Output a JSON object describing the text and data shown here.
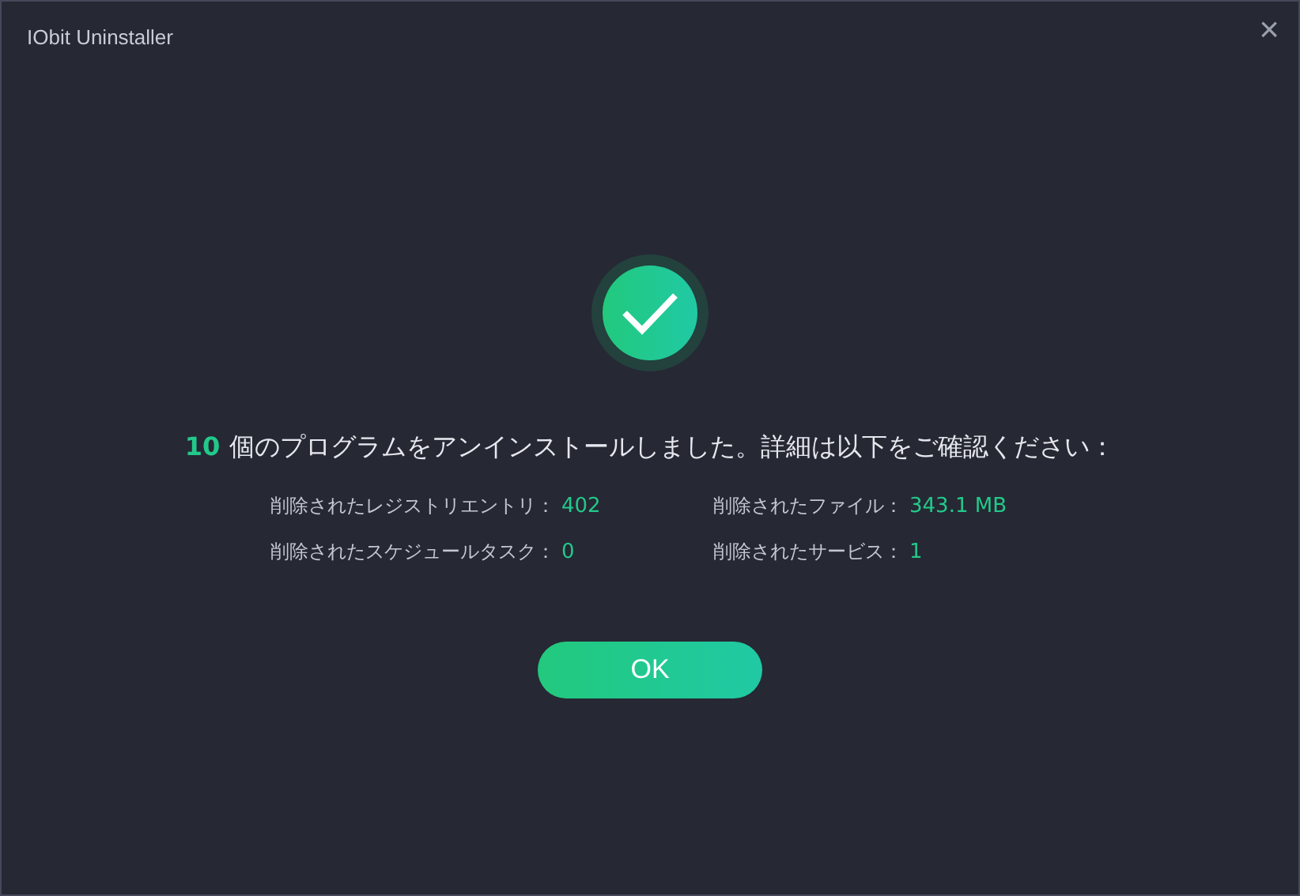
{
  "window": {
    "title": "IObit Uninstaller",
    "close": "×"
  },
  "message": {
    "count": "10",
    "text": "個のプログラムをアンインストールしました。詳細は以下をご確認ください："
  },
  "stats": [
    {
      "label": "削除されたレジストリエントリ：",
      "value": "402"
    },
    {
      "label": "削除されたファイル：",
      "value": "343.1 MB"
    },
    {
      "label": "削除されたスケジュールタスク：",
      "value": "0"
    },
    {
      "label": "削除されたサービス：",
      "value": "1"
    }
  ],
  "button": "OK"
}
